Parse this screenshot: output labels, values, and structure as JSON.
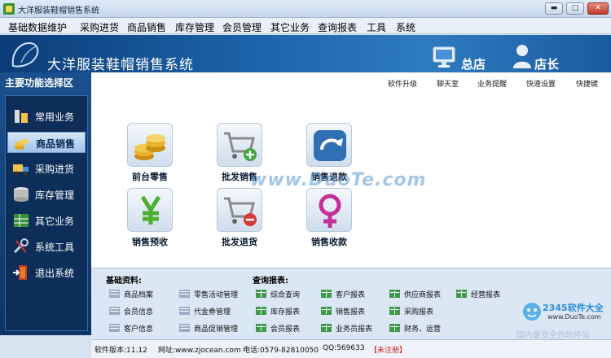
{
  "window": {
    "title": "大洋服装鞋帽销售系统",
    "controls": {
      "minimize": "▬",
      "maximize": "□",
      "close": "✕"
    }
  },
  "menu": {
    "items": [
      "基础数据维护",
      "采购进货",
      "商品销售",
      "库存管理",
      "会员管理",
      "其它业务",
      "查询报表",
      "工具",
      "系统"
    ]
  },
  "header": {
    "title": "大洋服装鞋帽销售系统",
    "store_label": "总店",
    "user_label": "店长"
  },
  "sidebar": {
    "title": "主要功能选择区",
    "items": [
      {
        "label": "常用业务",
        "active": false,
        "icon": "tools-icon"
      },
      {
        "label": "商品销售",
        "active": true,
        "icon": "coins-icon"
      },
      {
        "label": "采购进货",
        "active": false,
        "icon": "truck-icon"
      },
      {
        "label": "库存管理",
        "active": false,
        "icon": "database-icon"
      },
      {
        "label": "其它业务",
        "active": false,
        "icon": "grid-icon"
      },
      {
        "label": "系统工具",
        "active": false,
        "icon": "wrench-icon"
      },
      {
        "label": "退出系统",
        "active": false,
        "icon": "exit-door-icon"
      }
    ]
  },
  "quick_links": [
    "软件升级",
    "聊天室",
    "业务提醒",
    "快速设置",
    "快捷键"
  ],
  "tiles": [
    {
      "label": "前台零售",
      "icon": "coins-stack-icon"
    },
    {
      "label": "批发销售",
      "icon": "cart-add-icon"
    },
    {
      "label": "销售退款",
      "icon": "refresh-arrow-icon"
    },
    {
      "label": "销售预收",
      "icon": "yen-icon"
    },
    {
      "label": "批发退货",
      "icon": "cart-remove-icon"
    },
    {
      "label": "销售收款",
      "icon": "female-symbol-icon"
    }
  ],
  "watermark": "www.DuoTe.com",
  "basic_data": {
    "title": "基础资料:",
    "items": [
      "商品档案",
      "零售活动管理",
      "会员信息",
      "代金券管理",
      "客户信息",
      "商品促销管理"
    ]
  },
  "reports": {
    "title": "查询报表:",
    "items": [
      "综合查询",
      "客户报表",
      "供应商报表",
      "经营报表",
      "库存报表",
      "销售报表",
      "采购报表",
      "会员报表",
      "业务员报表",
      "财务、运营"
    ]
  },
  "status": {
    "version": "软件版本:11.12",
    "website": "网址:www.zjocean.com",
    "phone": "电话:0579-82810050",
    "qq": "QQ:569633",
    "reg": "【未注册】"
  },
  "badge": {
    "brand": "2345软件大全",
    "site": "www.DuoTe.com",
    "faded": "国内最安全的软件站"
  },
  "colors": {
    "header_dark": "#0c3c78",
    "header_light": "#2f7bc0",
    "sidebar_bg": "#1a4f8e",
    "active_item": "#9ec3ea",
    "unregistered": "#d21c1c"
  }
}
